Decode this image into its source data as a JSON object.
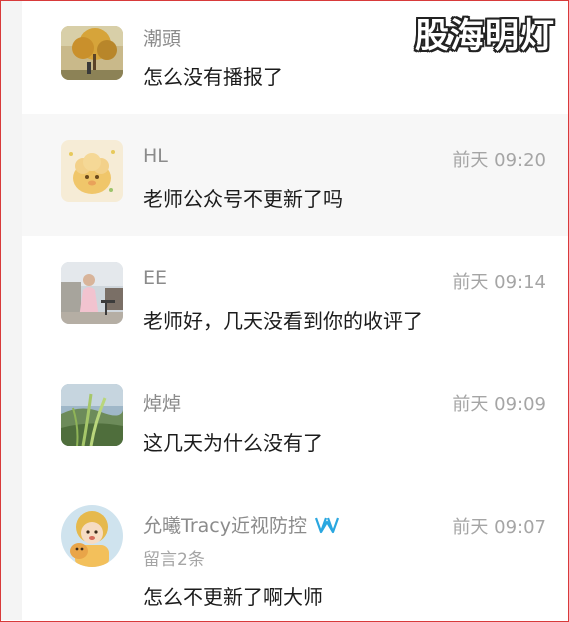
{
  "watermark": "股海明灯",
  "comments": [
    {
      "name": "潮頭",
      "time": "",
      "text": "怎么没有播报了",
      "avatar": "avatar-tree-photo"
    },
    {
      "name": "HL",
      "time": "前天 09:20",
      "text": "老师公众号不更新了吗",
      "avatar": "avatar-cartoon-sheep"
    },
    {
      "name": "EE",
      "time": "前天 09:14",
      "text": "老师好，几天没看到你的收评了",
      "avatar": "avatar-woman-photo"
    },
    {
      "name": "焯焯",
      "time": "前天 09:09",
      "text": "这几天为什么没有了",
      "avatar": "avatar-grass-photo"
    },
    {
      "name": "允曦Tracy近视防控",
      "time": "前天 09:07",
      "sub": "留言2条",
      "text": "怎么不更新了啊大师",
      "avatar": "avatar-cartoon-girl",
      "verified": "verified-icon"
    }
  ]
}
